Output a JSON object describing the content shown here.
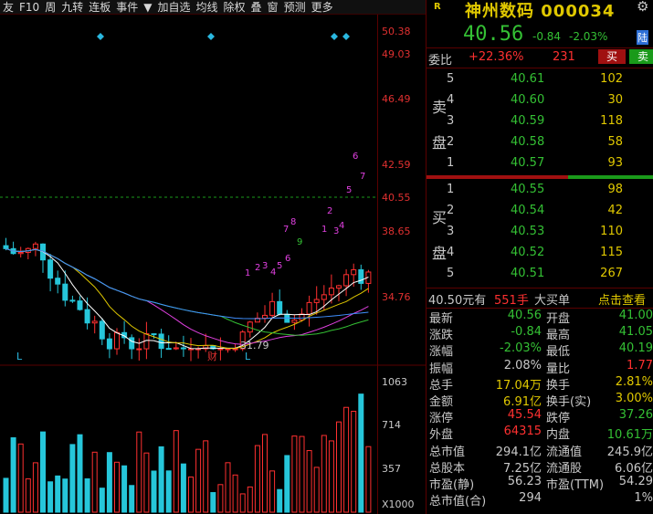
{
  "toolbar": {
    "items": [
      "友",
      "F10",
      "周",
      "九转",
      "连板",
      "事件",
      "▼",
      "加自选",
      "均线",
      "除权",
      "叠",
      "窗",
      "预测",
      "更多"
    ]
  },
  "chart": {
    "price_labels": [
      "50.38",
      "49.03",
      "46.49",
      "42.59",
      "40.55",
      "38.65",
      "34.76"
    ],
    "vol_labels": [
      "1063",
      "714",
      "357",
      "X1000"
    ],
    "low_label": "31.79",
    "markers": [
      "L",
      "财",
      "L"
    ],
    "signals": [
      "1",
      "2",
      "3",
      "4",
      "5",
      "6",
      "7",
      "8",
      "9",
      "2",
      "1",
      "3",
      "4",
      "5",
      "6",
      "7",
      "1",
      "2",
      "3"
    ]
  },
  "chart_data": {
    "type": "candlestick",
    "ylim": [
      31.79,
      50.38
    ],
    "current_price": 40.55,
    "volume_ylim": [
      0,
      1063
    ],
    "volume_unit": "X1000"
  },
  "quote": {
    "name": "神州数码",
    "code": "000034",
    "price": "40.56",
    "change": "-0.84",
    "change_pct": "-2.03%",
    "market_badge": "陆",
    "weibi_label": "委比",
    "weibi_value": "+22.36%",
    "weibi_diff": "231",
    "buy_btn": "买",
    "sell_btn": "卖",
    "sell_label_1": "卖",
    "sell_label_2": "盘",
    "buy_label_1": "买",
    "buy_label_2": "盘",
    "asks": [
      {
        "lvl": "5",
        "price": "40.61",
        "vol": "102"
      },
      {
        "lvl": "4",
        "price": "40.60",
        "vol": "30"
      },
      {
        "lvl": "3",
        "price": "40.59",
        "vol": "118"
      },
      {
        "lvl": "2",
        "price": "40.58",
        "vol": "58"
      },
      {
        "lvl": "1",
        "price": "40.57",
        "vol": "93"
      }
    ],
    "bids": [
      {
        "lvl": "1",
        "price": "40.55",
        "vol": "98"
      },
      {
        "lvl": "2",
        "price": "40.54",
        "vol": "42"
      },
      {
        "lvl": "3",
        "price": "40.53",
        "vol": "110"
      },
      {
        "lvl": "4",
        "price": "40.52",
        "vol": "115"
      },
      {
        "lvl": "5",
        "price": "40.51",
        "vol": "267"
      }
    ],
    "big_order_price": "40.50元有",
    "big_order_vol": "551手",
    "big_order_text": "大买单",
    "big_order_link": "点击查看",
    "stats_left": [
      {
        "label": "最新",
        "value": "40.56",
        "cls": "green"
      },
      {
        "label": "涨跌",
        "value": "-0.84",
        "cls": "green"
      },
      {
        "label": "涨幅",
        "value": "-2.03%",
        "cls": "green"
      },
      {
        "label": "振幅",
        "value": "2.08%",
        "cls": "white"
      },
      {
        "label": "总手",
        "value": "17.04万",
        "cls": "yellow"
      },
      {
        "label": "金额",
        "value": "6.91亿",
        "cls": "yellow"
      },
      {
        "label": "涨停",
        "value": "45.54",
        "cls": "red"
      },
      {
        "label": "外盘",
        "value": "64315",
        "cls": "red"
      },
      {
        "label": "总市值",
        "value": "294.1亿",
        "cls": "white"
      },
      {
        "label": "总股本",
        "value": "7.25亿",
        "cls": "white"
      },
      {
        "label": "市盈(静)",
        "value": "56.23",
        "cls": "white"
      },
      {
        "label": "总市值(合)",
        "value": "294",
        "cls": "white"
      }
    ],
    "stats_right": [
      {
        "label": "开盘",
        "value": "41.00",
        "cls": "green"
      },
      {
        "label": "最高",
        "value": "41.05",
        "cls": "green"
      },
      {
        "label": "最低",
        "value": "40.19",
        "cls": "green"
      },
      {
        "label": "量比",
        "value": "1.77",
        "cls": "red"
      },
      {
        "label": "换手",
        "value": "2.81%",
        "cls": "yellow"
      },
      {
        "label": "换手(实)",
        "value": "3.00%",
        "cls": "yellow"
      },
      {
        "label": "跌停",
        "value": "37.26",
        "cls": "green"
      },
      {
        "label": "内盘",
        "value": "10.61万",
        "cls": "green"
      },
      {
        "label": "流通值",
        "value": "245.9亿",
        "cls": "white"
      },
      {
        "label": "流通股",
        "value": "6.06亿",
        "cls": "white"
      },
      {
        "label": "市盈(TTM)",
        "value": "54.29",
        "cls": "white"
      },
      {
        "label": "",
        "value": "1%",
        "cls": "white"
      }
    ]
  }
}
